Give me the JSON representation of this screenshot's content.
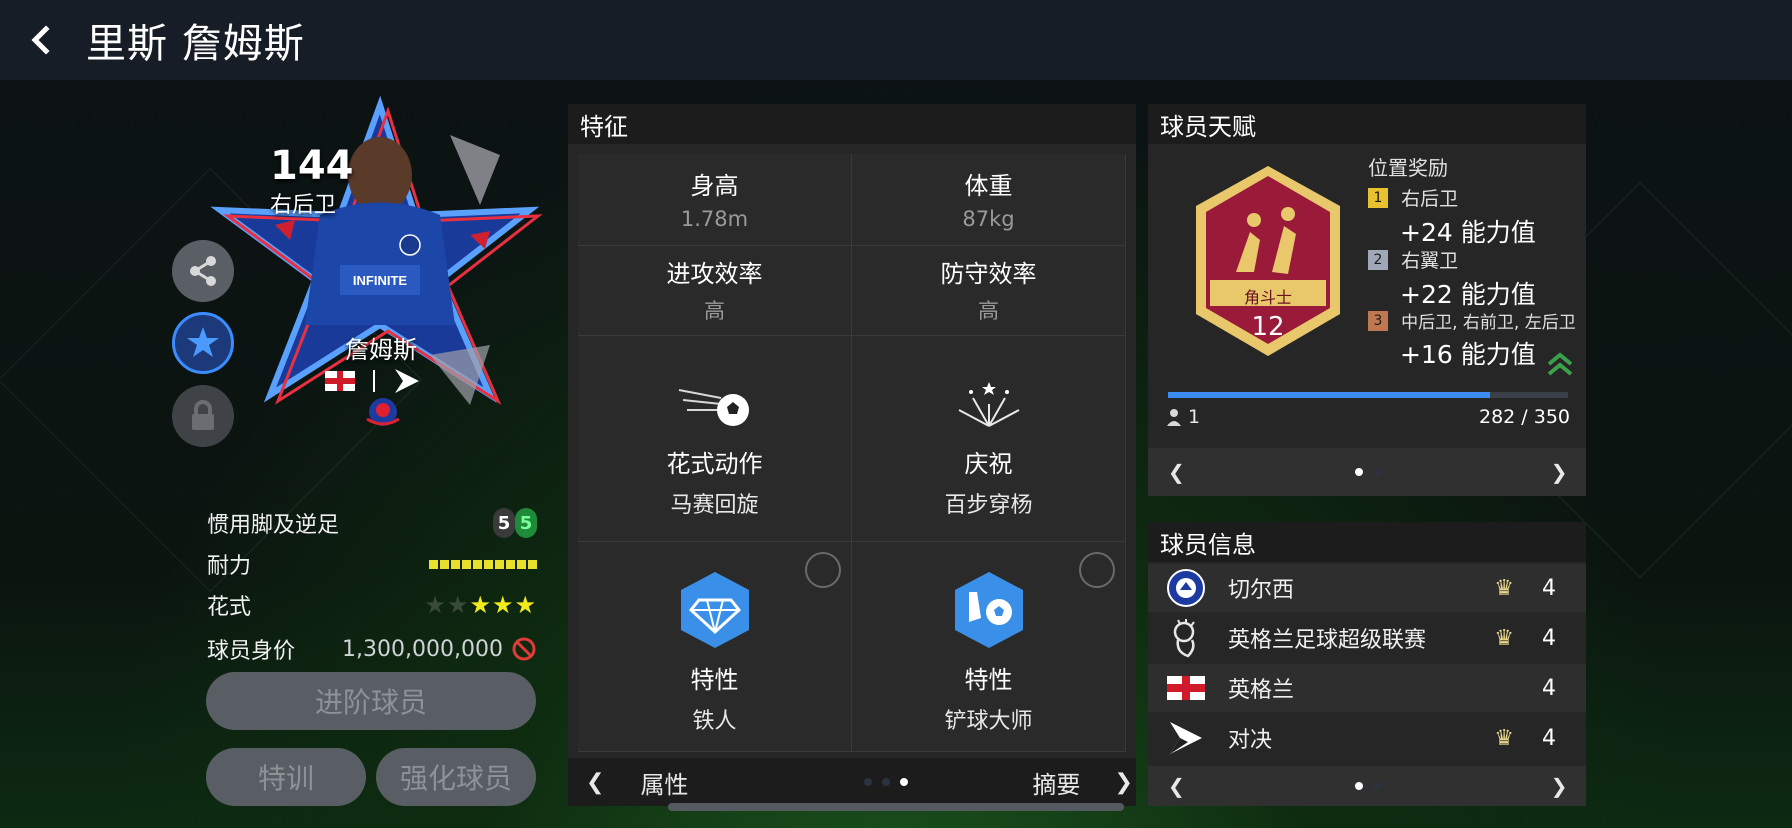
{
  "header": {
    "title": "里斯 詹姆斯"
  },
  "card": {
    "rating": "144",
    "position": "右后卫",
    "name": "詹姆斯"
  },
  "stats": {
    "foot_label": "惯用脚及逆足",
    "foot_left": "5",
    "foot_right": "5",
    "stamina_label": "耐力",
    "stamina_segments": 10,
    "skill_label": "花式",
    "skill_stars_total": 5,
    "skill_stars_filled": 3,
    "value_label": "球员身价",
    "value": "1,300,000,000"
  },
  "buttons": {
    "advance": "进阶球员",
    "train": "特训",
    "enhance": "强化球员"
  },
  "features": {
    "title": "特征",
    "height_label": "身高",
    "height_value": "1.78m",
    "weight_label": "体重",
    "weight_value": "87kg",
    "attack_label": "进攻效率",
    "attack_value": "高",
    "defense_label": "防守效率",
    "defense_value": "高",
    "skill_move_label": "花式动作",
    "skill_move_value": "马赛回旋",
    "celebration_label": "庆祝",
    "celebration_value": "百步穿杨",
    "trait1_label": "特性",
    "trait1_value": "铁人",
    "trait2_label": "特性",
    "trait2_value": "铲球大师",
    "footer_left": "属性",
    "footer_right": "摘要"
  },
  "talent": {
    "title": "球员天赋",
    "badge_name": "角斗士",
    "badge_level": "12",
    "bonus_title": "位置奖励",
    "bonuses": [
      {
        "num": "1",
        "position": "右后卫",
        "value": "+24 能力值",
        "color": "#e8c030"
      },
      {
        "num": "2",
        "position": "右翼卫",
        "value": "+22 能力值",
        "color": "#a0a8b8"
      },
      {
        "num": "3",
        "position": "中后卫, 右前卫, 左后卫",
        "value": "+16 能力值",
        "color": "#c07850"
      }
    ],
    "progress_current": 282,
    "progress_max": 350,
    "progress_text": "282 / 350",
    "owner_count": "1"
  },
  "info": {
    "title": "球员信息",
    "rows": [
      {
        "name": "切尔西",
        "level": "4",
        "icon": "chelsea-crest-icon"
      },
      {
        "name": "英格兰足球超级联赛",
        "level": "4",
        "icon": "premier-league-icon"
      },
      {
        "name": "英格兰",
        "level": "4",
        "icon": "england-flag-icon"
      },
      {
        "name": "对决",
        "level": "4",
        "icon": "versus-icon"
      }
    ]
  },
  "colors": {
    "accent_blue": "#3b8cff",
    "gold": "#e8c030",
    "stamina": "#e8e02a",
    "badge_red": "#9a1a3a"
  }
}
